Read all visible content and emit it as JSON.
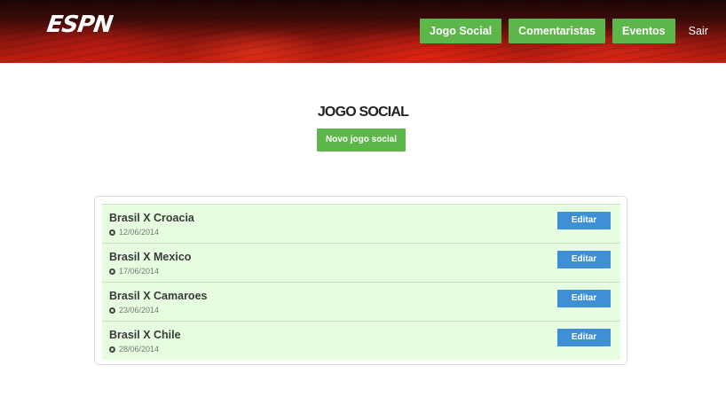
{
  "brand": {
    "logo_text": "ESPN"
  },
  "nav": {
    "items": [
      {
        "label": "Jogo Social"
      },
      {
        "label": "Comentaristas"
      },
      {
        "label": "Eventos"
      }
    ],
    "logout_label": "Sair"
  },
  "colors": {
    "nav_button": "#5cb64a",
    "edit_button": "#3f8fd6",
    "row_background": "#e6fde0"
  },
  "page": {
    "title": "JOGO SOCIAL",
    "new_button_label": "Novo jogo social"
  },
  "games": [
    {
      "title": "Brasil X Croacia",
      "date": "12/06/2014",
      "edit_label": "Editar",
      "icon": "soccer-ball-icon"
    },
    {
      "title": "Brasil X Mexico",
      "date": "17/06/2014",
      "edit_label": "Editar",
      "icon": "soccer-ball-icon"
    },
    {
      "title": "Brasil X Camaroes",
      "date": "23/06/2014",
      "edit_label": "Editar",
      "icon": "soccer-ball-icon"
    },
    {
      "title": "Brasil X Chile",
      "date": "28/06/2014",
      "edit_label": "Editar",
      "icon": "soccer-ball-icon"
    }
  ]
}
